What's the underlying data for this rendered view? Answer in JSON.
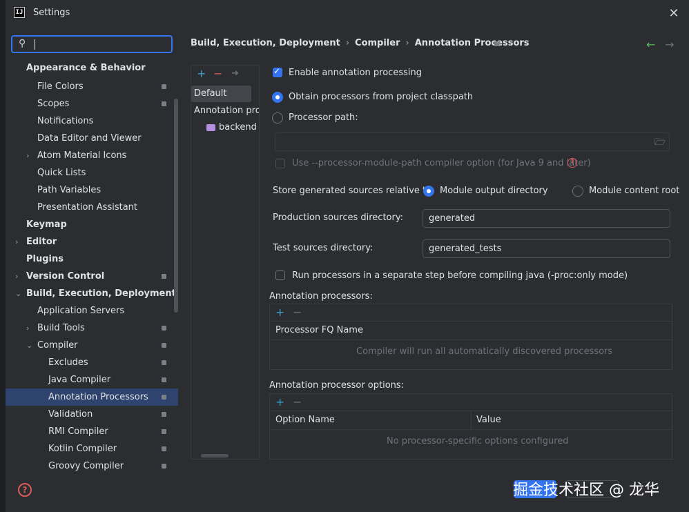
{
  "window": {
    "title": "Settings"
  },
  "search": {
    "value": ""
  },
  "sidebar": {
    "items": [
      {
        "label": "Appearance & Behavior"
      },
      {
        "label": "File Colors"
      },
      {
        "label": "Scopes"
      },
      {
        "label": "Notifications"
      },
      {
        "label": "Data Editor and Viewer"
      },
      {
        "label": "Atom Material Icons"
      },
      {
        "label": "Quick Lists"
      },
      {
        "label": "Path Variables"
      },
      {
        "label": "Presentation Assistant"
      },
      {
        "label": "Keymap"
      },
      {
        "label": "Editor"
      },
      {
        "label": "Plugins"
      },
      {
        "label": "Version Control"
      },
      {
        "label": "Build, Execution, Deployment"
      },
      {
        "label": "Application Servers"
      },
      {
        "label": "Build Tools"
      },
      {
        "label": "Compiler"
      },
      {
        "label": "Excludes"
      },
      {
        "label": "Java Compiler"
      },
      {
        "label": "Annotation Processors"
      },
      {
        "label": "Validation"
      },
      {
        "label": "RMI Compiler"
      },
      {
        "label": "Kotlin Compiler"
      },
      {
        "label": "Groovy Compiler"
      }
    ]
  },
  "breadcrumb": [
    "Build, Execution, Deployment",
    "Compiler",
    "Annotation Processors"
  ],
  "profiles": {
    "items": [
      "Default",
      "Annotation profi",
      "backend"
    ]
  },
  "settings": {
    "enable_processing": "Enable annotation processing",
    "obtain_from_classpath": "Obtain processors from project classpath",
    "processor_path": "Processor path:",
    "processor_path_value": "",
    "use_module_path": "Use --processor-module-path compiler option (for Java 9 and later)",
    "store_relative_to": "Store generated sources relative to:",
    "module_output_directory": "Module output directory",
    "module_content_root": "Module content root",
    "production_sources_label": "Production sources directory:",
    "production_sources_value": "generated",
    "test_sources_label": "Test sources directory:",
    "test_sources_value": "generated_tests",
    "run_separate_step": "Run processors in a separate step before compiling java (-proc:only mode)"
  },
  "processors_table": {
    "title": "Annotation processors:",
    "column": "Processor FQ Name",
    "empty": "Compiler will run all automatically discovered processors"
  },
  "options_table": {
    "title": "Annotation processor options:",
    "columns": [
      "Option Name",
      "Value"
    ],
    "empty": "No processor-specific options configured"
  },
  "watermark": "掘金技术社区 @ 龙华",
  "colors": {
    "accent": "#3574f0",
    "background": "#2b2d30",
    "selection": "#2e436e",
    "error": "#db5c5c",
    "nav_back": "#5fb865"
  }
}
